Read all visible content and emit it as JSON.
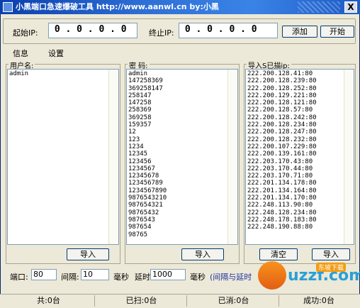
{
  "window": {
    "title": "小黑端口急速爆破工具   http://www.aanwl.cn   by:小黑",
    "close_label": "X"
  },
  "ip_panel": {
    "start_label": "起始IP:",
    "start_value": " 0 . 0 . 0 . 0",
    "end_label": "终止IP:",
    "end_value": " 0 . 0 . 0 . 0",
    "add_label": "添加",
    "start_button": "开始"
  },
  "menu": {
    "info": "信息",
    "settings": "设置"
  },
  "username_group": {
    "title": "用户名:",
    "items": [
      "admin"
    ],
    "import_label": "导入"
  },
  "password_group": {
    "title": "密 码:",
    "items": [
      "admin",
      "147258369",
      "369258147",
      "258147",
      "147258",
      "258369",
      "369258",
      "159357",
      "12",
      "123",
      "1234",
      "12345",
      "123456",
      "1234567",
      "12345678",
      "123456789",
      "1234567890",
      "9876543210",
      "987654321",
      "98765432",
      "9876543",
      "987654",
      "98765"
    ],
    "import_label": "导入"
  },
  "scanned_group": {
    "title": "导入S已描ip:",
    "items": [
      "222.200.128.41:80",
      "222.200.128.239:80",
      "222.200.128.252:80",
      "222.200.129.221:80",
      "222.200.128.121:80",
      "222.200.128.57:80",
      "222.200.128.242:80",
      "222.200.128.234:80",
      "222.200.128.247:80",
      "222.200.128.232:80",
      "222.200.107.229:80",
      "222.200.139.161:80",
      "222.203.170.43:80",
      "222.203.170.44:80",
      "222.203.170.71:80",
      "222.201.134.178:80",
      "222.201.134.164:80",
      "222.201.134.170:80",
      "222.248.113.90:80",
      "222.248.128.234:80",
      "222.248.178.183:80",
      "222.248.190.88:80"
    ],
    "clear_label": "清空",
    "import_label": "导入"
  },
  "options": {
    "port_label": "端口:",
    "port_value": "80",
    "interval_label": "间隔:",
    "interval_value": "10",
    "interval_unit": "毫秒",
    "delay_label": "延时:",
    "delay_value": "1000",
    "delay_unit": "毫秒",
    "note": "(间隔与延时"
  },
  "status": {
    "total": "共:0台",
    "scanned": "已扫:0台",
    "used": "已消:0台",
    "success": "成功:0台"
  },
  "watermark": {
    "text": "uzzf.com",
    "badge": "东坡下载"
  }
}
